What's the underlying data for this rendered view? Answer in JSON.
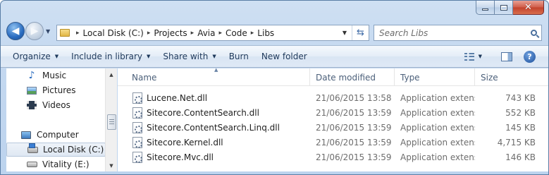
{
  "window": {
    "minimize_glyph": "minimize-icon",
    "maximize_glyph": "maximize-icon",
    "close_glyph": "✕"
  },
  "nav": {
    "back_glyph": "◀",
    "forward_glyph": "▶",
    "recent_glyph": "▼"
  },
  "address": {
    "crumbs": [
      "Local Disk (C:)",
      "Projects",
      "Avia",
      "Code",
      "Libs"
    ],
    "separator": "▸",
    "dropdown_glyph": "▼",
    "refresh_glyph": "⇆"
  },
  "search": {
    "placeholder": "Search Libs"
  },
  "toolbar": {
    "organize": "Organize",
    "include": "Include in library",
    "share": "Share with",
    "burn": "Burn",
    "new_folder": "New folder",
    "dropdown_glyph": "▼",
    "help_glyph": "?"
  },
  "nav_pane": {
    "items": [
      {
        "label": "Music",
        "icon": "music-icon"
      },
      {
        "label": "Pictures",
        "icon": "pictures-icon"
      },
      {
        "label": "Videos",
        "icon": "videos-icon"
      },
      {
        "label": "Computer",
        "icon": "computer-icon"
      },
      {
        "label": "Local Disk (C:)",
        "icon": "local-disk-icon",
        "selected": true
      },
      {
        "label": "Vitality (E:)",
        "icon": "drive-icon"
      }
    ],
    "music_glyph": "♪"
  },
  "file_list": {
    "columns": {
      "name": "Name",
      "date": "Date modified",
      "type": "Type",
      "size": "Size"
    },
    "sort_glyph": "▲",
    "rows": [
      {
        "name": "Lucene.Net.dll",
        "date": "21/06/2015 13:58",
        "type": "Application extens...",
        "size": "743 KB"
      },
      {
        "name": "Sitecore.ContentSearch.dll",
        "date": "21/06/2015 13:59",
        "type": "Application extens...",
        "size": "552 KB"
      },
      {
        "name": "Sitecore.ContentSearch.Linq.dll",
        "date": "21/06/2015 13:59",
        "type": "Application extens...",
        "size": "145 KB"
      },
      {
        "name": "Sitecore.Kernel.dll",
        "date": "21/06/2015 13:59",
        "type": "Application extens...",
        "size": "4,715 KB"
      },
      {
        "name": "Sitecore.Mvc.dll",
        "date": "21/06/2015 13:59",
        "type": "Application extens...",
        "size": "146 KB"
      }
    ]
  },
  "scrollbar": {
    "up_glyph": "▲",
    "down_glyph": "▼"
  }
}
